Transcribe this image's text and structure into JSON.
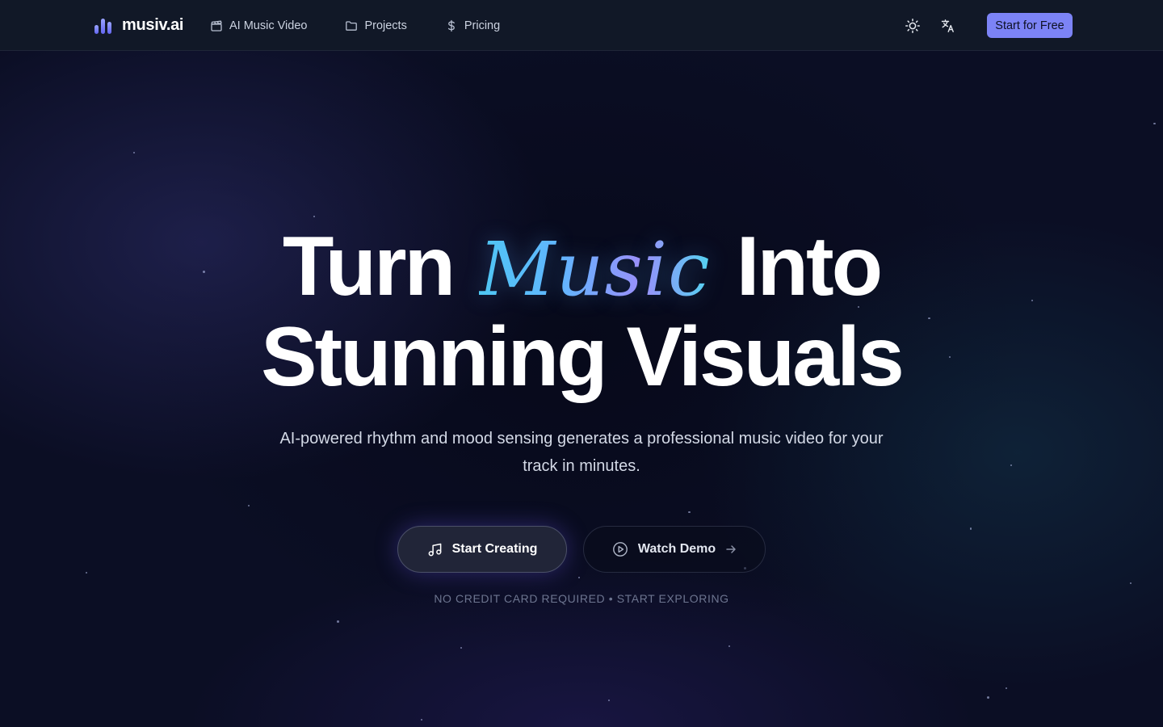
{
  "header": {
    "brand": "musiv.ai",
    "nav": [
      {
        "label": "AI Music Video",
        "icon": "clapperboard-icon"
      },
      {
        "label": "Projects",
        "icon": "folder-icon"
      },
      {
        "label": "Pricing",
        "icon": "dollar-icon"
      }
    ],
    "theme_icon": "sun-icon",
    "language_icon": "translate-icon",
    "cta_label": "Start for Free"
  },
  "hero": {
    "title_part1": "Turn",
    "title_accent": "Music",
    "title_part2": "Into",
    "title_line2": "Stunning Visuals",
    "subtitle": "AI-powered rhythm and mood sensing generates a professional music video for your track in minutes.",
    "primary_button": {
      "label": "Start Creating",
      "icon": "music-note-icon"
    },
    "secondary_button": {
      "label": "Watch Demo",
      "icon": "play-circle-icon",
      "trailing_icon": "arrow-right-icon"
    },
    "note": "NO CREDIT CARD REQUIRED • START EXPLORING"
  },
  "colors": {
    "header_bg": "#111827",
    "page_bg": "#0b0e24",
    "accent_button": "#7c83f6",
    "accent_gradient": [
      "#4fc9f3",
      "#a28ef9"
    ]
  }
}
